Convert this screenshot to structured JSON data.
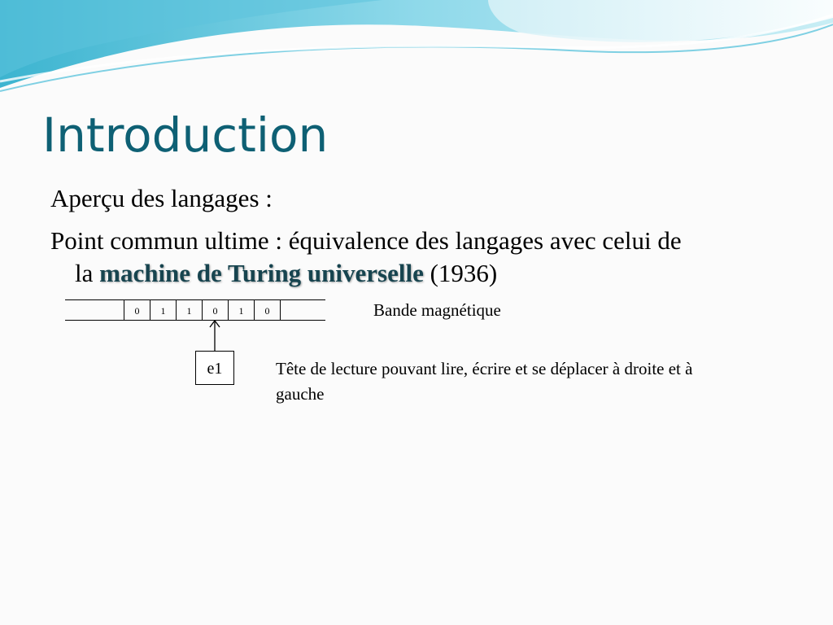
{
  "slide": {
    "title": "Introduction",
    "bullets": {
      "first": "Aperçu des langages :",
      "second_part1": "Point commun ultime : équivalence des langages avec celui de",
      "second_part2": "la",
      "second_highlight": "machine de Turing universelle",
      "second_part3": "(1936)"
    },
    "diagram": {
      "tape_cells": [
        "",
        "",
        "0",
        "1",
        "1",
        "0",
        "1",
        "0",
        "",
        ""
      ],
      "head_state": "e1",
      "tape_label": "Bande magnétique",
      "head_label": "Tête de lecture pouvant lire, écrire et se déplacer à droite et à gauche"
    }
  },
  "colors": {
    "title": "#0e6074",
    "wave_light": "#b7e6ef",
    "wave_mid": "#6ccbe0",
    "wave_dark": "#2fa8c6"
  }
}
